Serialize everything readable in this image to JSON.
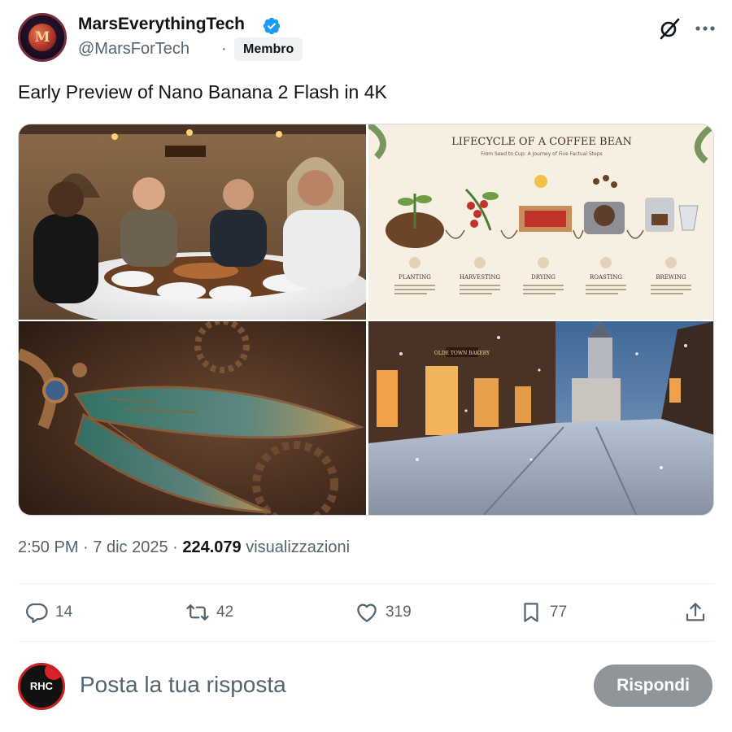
{
  "author": {
    "name": "MarsEverythingTech",
    "handle": "@MarsForTech",
    "separator": "·",
    "badge": "Membro",
    "verified": true,
    "verified_color": "#1d9bf0"
  },
  "tweet": {
    "text": "Early Preview of Nano Banana 2 Flash in 4K"
  },
  "media": [
    {
      "alt": "Restaurant scene with four men dining at a round table"
    },
    {
      "infographic": {
        "title": "LIFECYCLE OF A COFFEE BEAN",
        "subtitle": "From Seed to Cup: A Journey of Five Factual Steps",
        "steps": [
          {
            "label": "PLANTING"
          },
          {
            "label": "HARVESTING"
          },
          {
            "label": "DRYING"
          },
          {
            "label": "ROASTING"
          },
          {
            "label": "BREWING"
          }
        ]
      }
    },
    {
      "alt": "Steampunk mechanical dragonfly with stained-glass wings"
    },
    {
      "alt": "Snowy old-town street at dusk",
      "shop_sign": "OLDE TOWN BAKERY"
    }
  ],
  "meta": {
    "time": "2:50 PM",
    "date": "7 dic 2025",
    "views_count": "224.079",
    "views_label": "visualizzazioni"
  },
  "actions": {
    "replies": "14",
    "reposts": "42",
    "likes": "319",
    "bookmarks": "77"
  },
  "reply_box": {
    "placeholder": "Posta la tua risposta",
    "avatar_text": "RHC",
    "button_label": "Rispondi"
  },
  "colors": {
    "text": "#0f1419",
    "secondary": "#536471",
    "accent": "#1d9bf0",
    "reply_button_disabled": "#8f9599"
  }
}
